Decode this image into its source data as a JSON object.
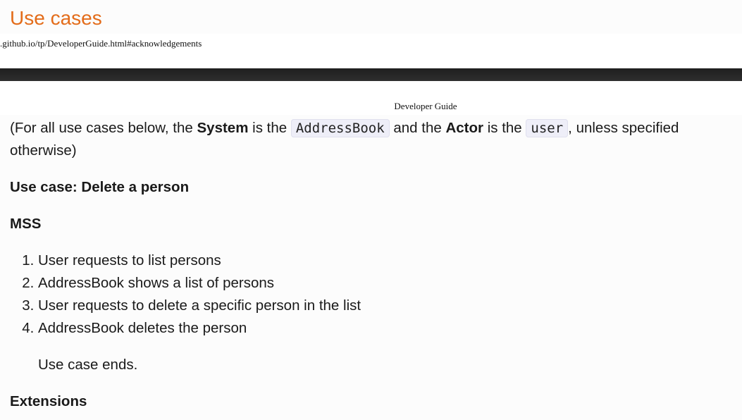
{
  "heading": "Use cases",
  "print_header": {
    "url": ".github.io/tp/DeveloperGuide.html#acknowledgements",
    "title": "Developer Guide"
  },
  "intro": {
    "prefix": "(For all use cases below, the ",
    "system_label": "System",
    "is_the_1": " is the ",
    "system_value": "AddressBook",
    "and_the": " and the ",
    "actor_label": "Actor",
    "is_the_2": " is the ",
    "actor_value": "user",
    "suffix": ", unless specified otherwise)"
  },
  "use_case_title": "Use case: Delete a person",
  "mss_heading": "MSS",
  "steps": [
    "User requests to list persons",
    "AddressBook shows a list of persons",
    "User requests to delete a specific person in the list",
    "AddressBook deletes the person"
  ],
  "use_case_ends": "Use case ends.",
  "extensions_heading": "Extensions",
  "colors": {
    "heading": "#e36c1a",
    "text": "#1a1a1a",
    "code_background": "#eeeef8",
    "dark_bar": "#262626"
  }
}
